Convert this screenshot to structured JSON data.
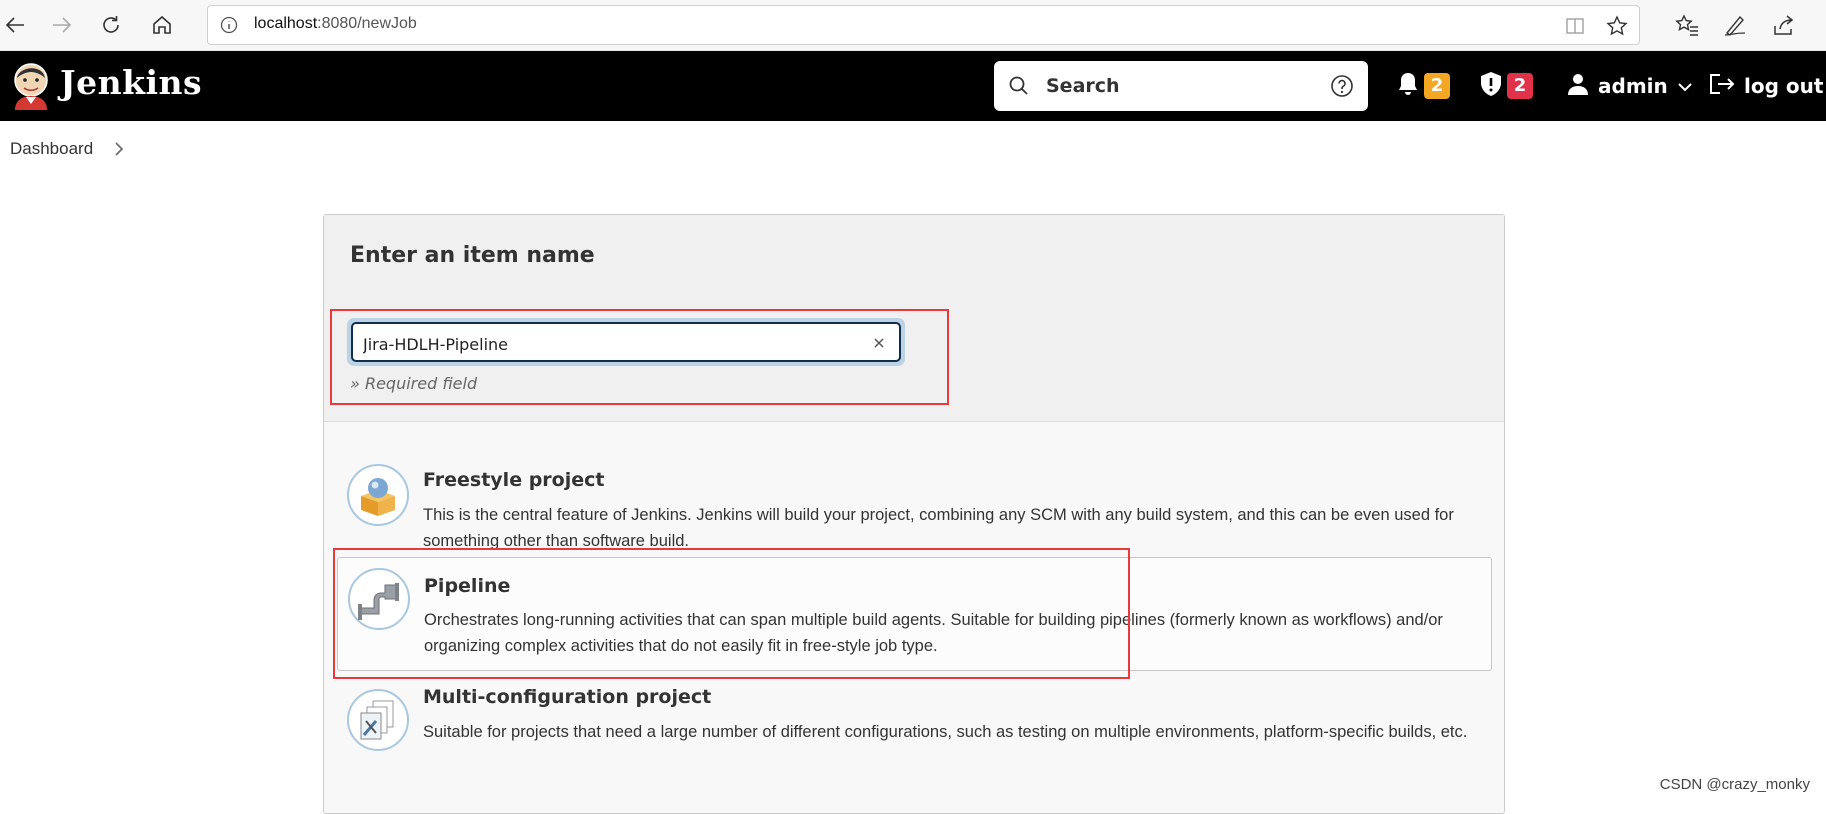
{
  "browser": {
    "url_host": "localhost",
    "url_path": ":8080/newJob"
  },
  "header": {
    "title": "Jenkins",
    "search_placeholder": "Search",
    "notifications_count": "2",
    "security_count": "2",
    "user": "admin",
    "logout": "log out",
    "colors": {
      "bg": "#000000",
      "notify": "#f5a623",
      "security": "#e1324a"
    }
  },
  "breadcrumb": [
    "Dashboard"
  ],
  "form": {
    "heading": "Enter an item name",
    "name_value": "Jira-HDLH-Pipeline",
    "required": "» Required field"
  },
  "items": [
    {
      "label": "Freestyle project",
      "desc": "This is the central feature of Jenkins. Jenkins will build your project, combining any SCM with any build system, and this can be even used for something other than software build.",
      "icon": "freestyle-project-icon"
    },
    {
      "label": "Pipeline",
      "desc": "Orchestrates long-running activities that can span multiple build agents. Suitable for building pipelines (formerly known as workflows) and/or organizing complex activities that do not easily fit in free-style job type.",
      "icon": "pipeline-icon",
      "selected": true
    },
    {
      "label": "Multi-configuration project",
      "desc": "Suitable for projects that need a large number of different configurations, such as testing on multiple environments, platform-specific builds, etc.",
      "icon": "multi-configuration-project-icon"
    }
  ],
  "watermark": "CSDN @crazy_monky"
}
